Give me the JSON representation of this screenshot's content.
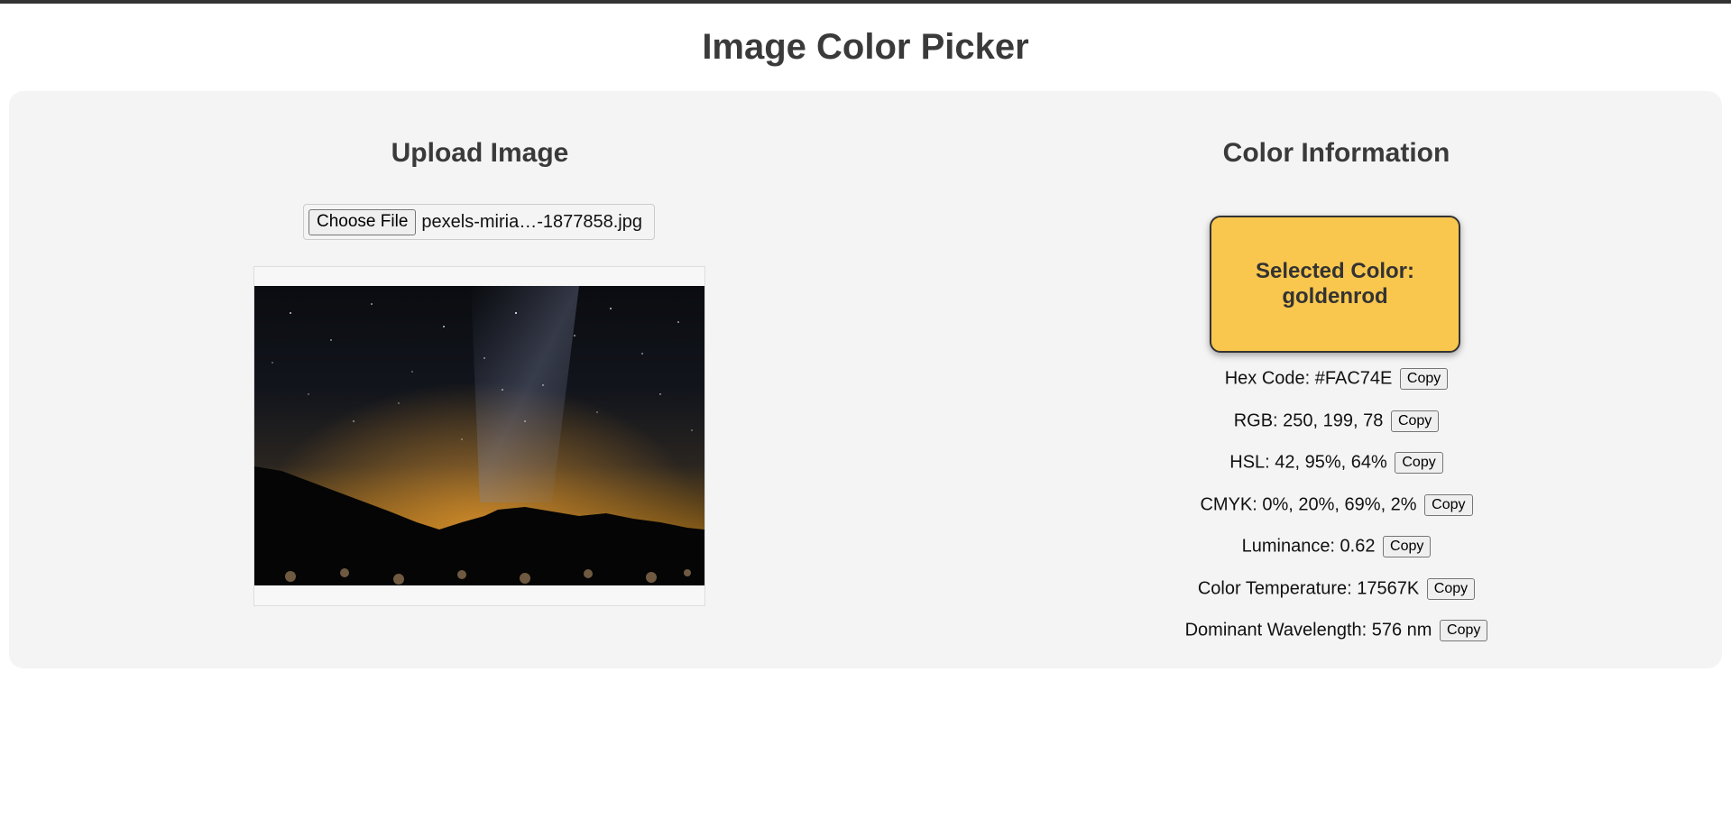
{
  "page": {
    "title": "Image Color Picker"
  },
  "upload": {
    "heading": "Upload Image",
    "choose_label": "Choose File",
    "file_name": "pexels-miria…-1877858.jpg"
  },
  "info": {
    "heading": "Color Information",
    "swatch_color": "#FAC74E",
    "selected_prefix": "Selected Color:",
    "selected_name": "goldenrod",
    "copy_label": "Copy",
    "rows": [
      {
        "text": "Hex Code: #FAC74E"
      },
      {
        "text": "RGB: 250, 199, 78"
      },
      {
        "text": "HSL: 42, 95%, 64%"
      },
      {
        "text": "CMYK: 0%, 20%, 69%, 2%"
      },
      {
        "text": "Luminance: 0.62"
      },
      {
        "text": "Color Temperature: 17567K"
      },
      {
        "text": "Dominant Wavelength: 576 nm"
      }
    ]
  }
}
